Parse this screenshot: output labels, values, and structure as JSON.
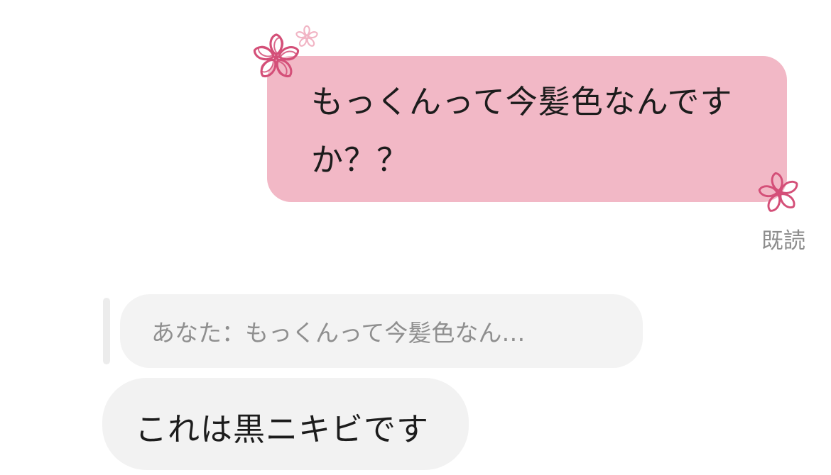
{
  "conversation": {
    "outgoing": {
      "text": "もっくんって今髪色なんですか？？",
      "status": "既読",
      "bubble_color": "#f2b8c6",
      "decorations": [
        "flower-icon",
        "small-flower-icon",
        "flower-icon"
      ]
    },
    "incoming": {
      "reply_quote": "あなた：もっくんって今髪色なん…",
      "text": "これは黒ニキビです",
      "bubble_color": "#f2f2f2"
    }
  },
  "colors": {
    "flower": "#d44f78",
    "flower_light": "#f1b4c4",
    "read_status": "#8d8d8d"
  }
}
